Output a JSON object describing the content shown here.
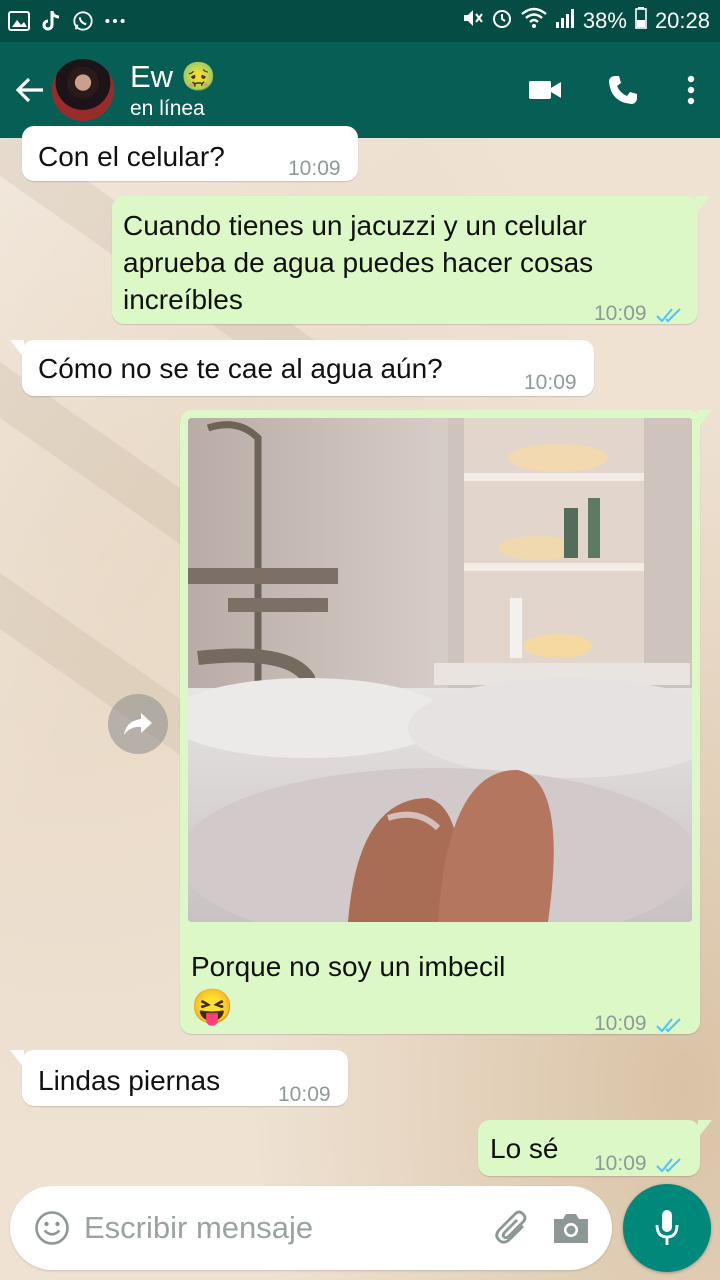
{
  "status_bar": {
    "icons_left": [
      "gallery-icon",
      "tiktok-icon",
      "whatsapp-icon",
      "more-notifications-icon"
    ],
    "battery": "38%",
    "time": "20:28"
  },
  "header": {
    "contact_name": "Ew",
    "contact_emoji": "🤢",
    "status": "en línea"
  },
  "messages": [
    {
      "direction": "in",
      "text": "Con el celular?",
      "time": "10:09"
    },
    {
      "direction": "out",
      "text": "Cuando tienes un jacuzzi y un celular aprueba de agua puedes hacer cosas increíbles",
      "time": "10:09",
      "read": true
    },
    {
      "direction": "in",
      "text": "Cómo no se te cae al agua aún?",
      "time": "10:09"
    },
    {
      "direction": "out",
      "image": true,
      "text": "Porque no soy un imbecil",
      "emoji": "😝",
      "time": "10:09",
      "read": true
    },
    {
      "direction": "in",
      "text": "Lindas piernas",
      "time": "10:09"
    },
    {
      "direction": "out",
      "text": "Lo sé",
      "time": "10:09",
      "read": true
    }
  ],
  "input": {
    "placeholder": "Escribir mensaje"
  },
  "colors": {
    "header": "#075e54",
    "status_bar": "#054d44",
    "outgoing_bubble": "#dcf8c6",
    "incoming_bubble": "#ffffff",
    "read_ticks": "#4fc3f7",
    "mic_button": "#00897b"
  }
}
